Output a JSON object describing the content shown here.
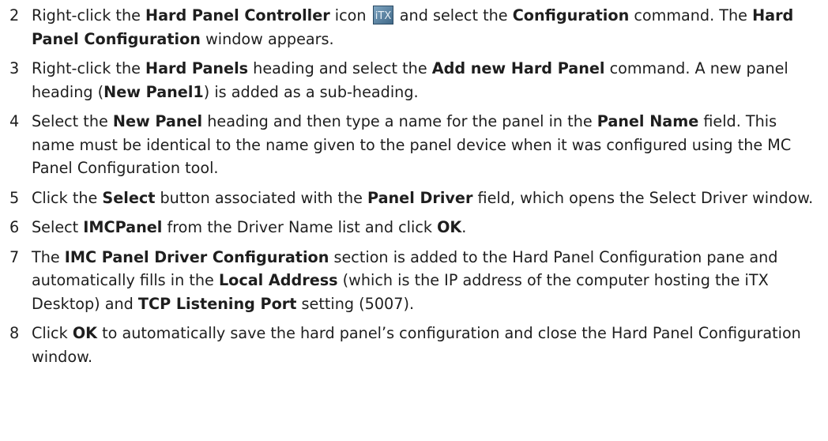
{
  "steps": [
    {
      "number": "2",
      "parts": [
        {
          "t": "Right-click the ",
          "b": false
        },
        {
          "t": "Hard Panel Controller",
          "b": true
        },
        {
          "t": " icon ",
          "b": false
        },
        {
          "icon": "itx-icon",
          "label": "iTX"
        },
        {
          "t": " and select the ",
          "b": false
        },
        {
          "t": "Configuration",
          "b": true
        },
        {
          "t": " command. The ",
          "b": false
        },
        {
          "t": "Hard Panel Configuration",
          "b": true
        },
        {
          "t": " window appears.",
          "b": false
        }
      ]
    },
    {
      "number": "3",
      "parts": [
        {
          "t": "Right-click the ",
          "b": false
        },
        {
          "t": "Hard Panels",
          "b": true
        },
        {
          "t": " heading and select the ",
          "b": false
        },
        {
          "t": "Add new Hard Panel",
          "b": true
        },
        {
          "t": " command. A new panel heading (",
          "b": false
        },
        {
          "t": "New Panel1",
          "b": true
        },
        {
          "t": ") is added as a sub-heading.",
          "b": false
        }
      ]
    },
    {
      "number": "4",
      "parts": [
        {
          "t": "Select the ",
          "b": false
        },
        {
          "t": "New Panel",
          "b": true
        },
        {
          "t": " heading and then type a name for the panel in the ",
          "b": false
        },
        {
          "t": "Panel Name",
          "b": true
        },
        {
          "t": " field. This name must be identical to the name given to the panel device when it was configured using the MC Panel Configuration tool.",
          "b": false
        }
      ]
    },
    {
      "number": "5",
      "parts": [
        {
          "t": "Click the ",
          "b": false
        },
        {
          "t": "Select",
          "b": true
        },
        {
          "t": " button associated with the ",
          "b": false
        },
        {
          "t": "Panel Driver",
          "b": true
        },
        {
          "t": " field, which opens the Select Driver window.",
          "b": false
        }
      ]
    },
    {
      "number": "6",
      "parts": [
        {
          "t": "Select ",
          "b": false
        },
        {
          "t": "IMCPanel",
          "b": true
        },
        {
          "t": " from the Driver Name list and click ",
          "b": false
        },
        {
          "t": "OK",
          "b": true
        },
        {
          "t": ".",
          "b": false
        }
      ]
    },
    {
      "number": "7",
      "parts": [
        {
          "t": "The ",
          "b": false
        },
        {
          "t": "IMC Panel Driver Configuration",
          "b": true
        },
        {
          "t": " section is added to the Hard Panel Configuration pane and automatically fills in the ",
          "b": false
        },
        {
          "t": "Local Address",
          "b": true
        },
        {
          "t": " (which is the IP address of the computer hosting the iTX Desktop) and ",
          "b": false
        },
        {
          "t": "TCP Listening Port",
          "b": true
        },
        {
          "t": " setting (5007).",
          "b": false
        }
      ]
    },
    {
      "number": "8",
      "parts": [
        {
          "t": "Click ",
          "b": false
        },
        {
          "t": "OK",
          "b": true
        },
        {
          "t": " to automatically save the hard panel’s configuration and close the Hard Panel Configuration window.",
          "b": false
        }
      ]
    }
  ]
}
